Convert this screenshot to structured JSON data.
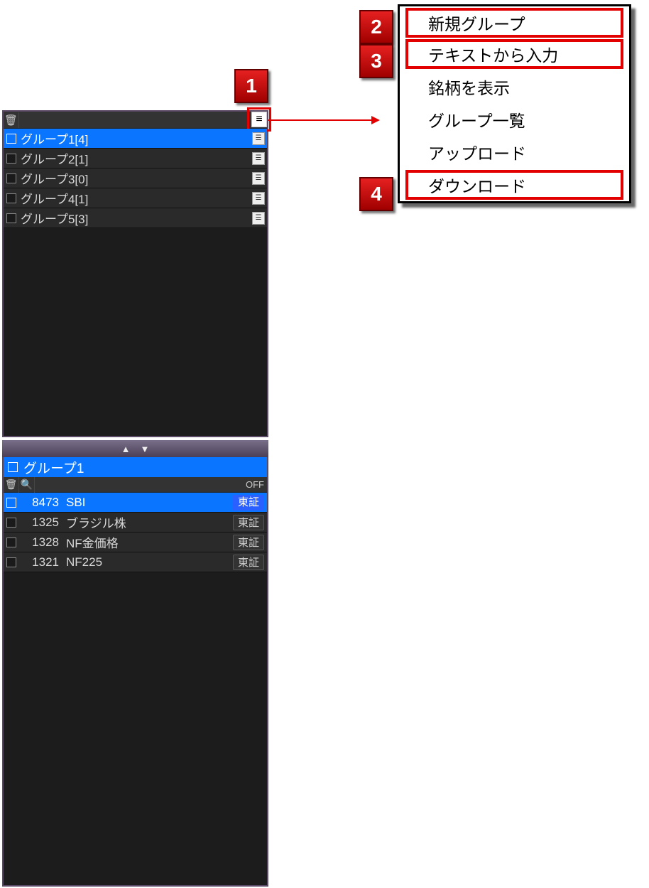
{
  "badges": {
    "b1": "1",
    "b2": "2",
    "b3": "3",
    "b4": "4"
  },
  "group_panel": {
    "groups": [
      {
        "label": "グループ1[4]",
        "selected": true
      },
      {
        "label": "グループ2[1]",
        "selected": false
      },
      {
        "label": "グループ3[0]",
        "selected": false
      },
      {
        "label": "グループ4[1]",
        "selected": false
      },
      {
        "label": "グループ5[3]",
        "selected": false
      }
    ]
  },
  "stock_panel": {
    "title": "グループ1",
    "off_label": "OFF",
    "rows": [
      {
        "code": "8473",
        "name": "SBI",
        "exchange": "東証",
        "selected": true
      },
      {
        "code": "1325",
        "name": "ブラジル株",
        "exchange": "東証",
        "selected": false
      },
      {
        "code": "1328",
        "name": "NF金価格",
        "exchange": "東証",
        "selected": false
      },
      {
        "code": "1321",
        "name": "NF225",
        "exchange": "東証",
        "selected": false
      }
    ]
  },
  "context_menu": {
    "items": [
      {
        "label": "新規グループ",
        "highlighted": true
      },
      {
        "label": "テキストから入力",
        "highlighted": true
      },
      {
        "label": "銘柄を表示",
        "highlighted": false
      },
      {
        "label": "グループ一覧",
        "highlighted": false
      },
      {
        "label": "アップロード",
        "highlighted": false
      },
      {
        "label": "ダウンロード",
        "highlighted": true
      }
    ]
  }
}
